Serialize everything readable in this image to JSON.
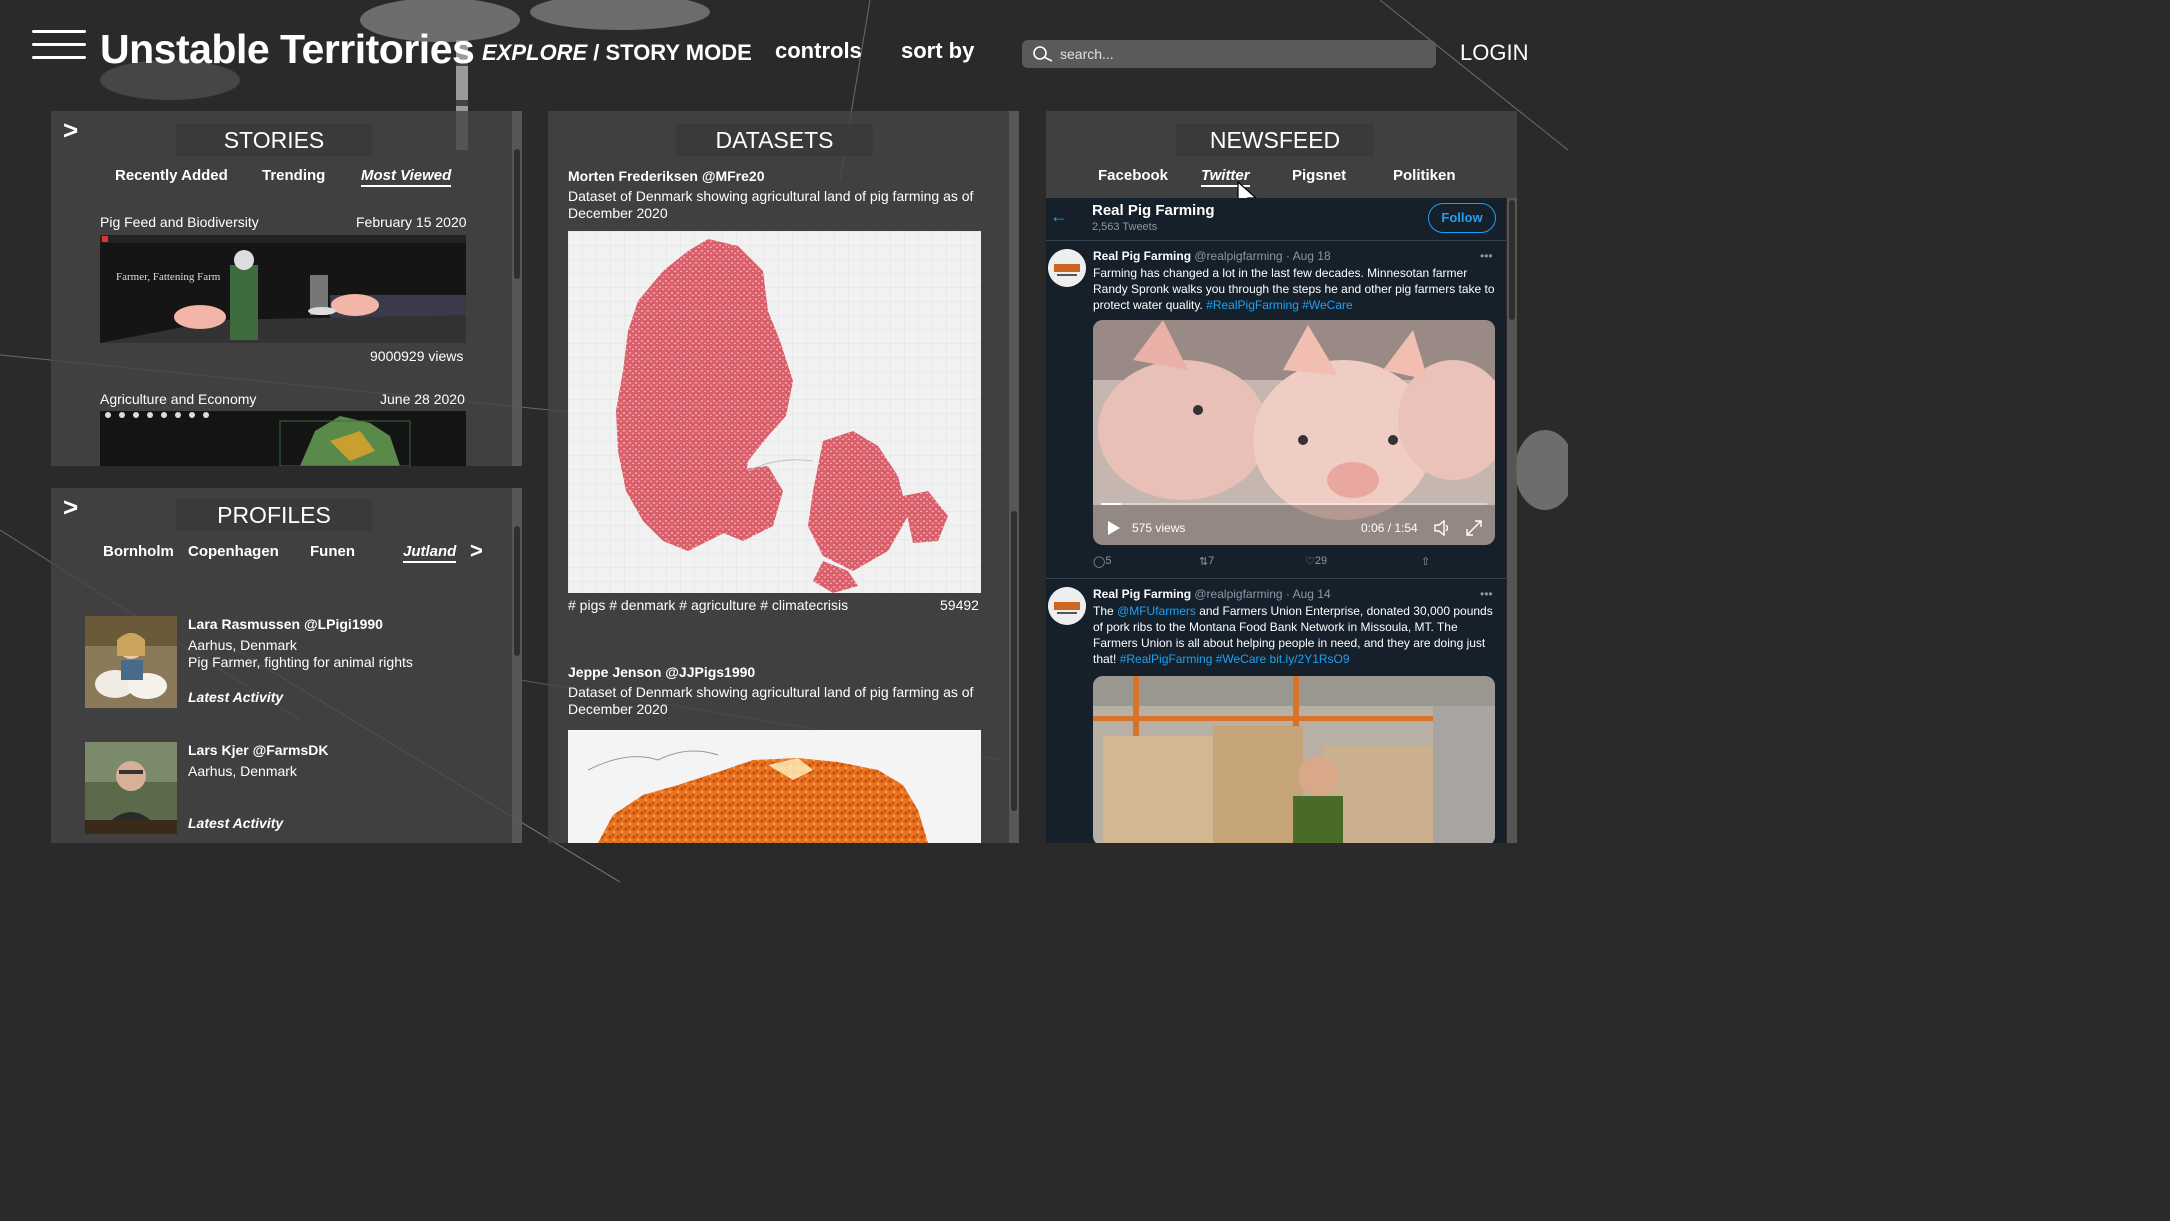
{
  "header": {
    "title": "Unstable Territories",
    "mode_explore": "EXPLORE",
    "mode_sep": " / ",
    "mode_story": "STORY MODE",
    "controls": "controls",
    "sort_by": "sort by",
    "search_placeholder": "search...",
    "login": "LOGIN"
  },
  "stories": {
    "title": "STORIES",
    "collapse": ">",
    "tabs": [
      "Recently Added",
      "Trending",
      "Most Viewed"
    ],
    "active_tab": "Most Viewed",
    "items": [
      {
        "title": "Pig Feed and Biodiversity",
        "date": "February 15 2020",
        "views": "9000929 views",
        "thumb_caption": "Farmer, Fattening Farm"
      },
      {
        "title": "Agriculture and Economy",
        "date": "June 28 2020"
      }
    ]
  },
  "profiles": {
    "title": "PROFILES",
    "collapse": ">",
    "tabs": [
      "Bornholm",
      "Copenhagen",
      "Funen",
      "Jutland"
    ],
    "active_tab": "Jutland",
    "next": ">",
    "items": [
      {
        "name": "Lara Rasmussen @LPigi1990",
        "location": "Aarhus, Denmark",
        "bio": "Pig Farmer, fighting for animal rights",
        "activity": "Latest Activity"
      },
      {
        "name": "Lars Kjer @FarmsDK",
        "location": "Aarhus, Denmark",
        "activity": "Latest Activity"
      }
    ]
  },
  "datasets": {
    "title": "DATASETS",
    "items": [
      {
        "author": "Morten Frederiksen @MFre20",
        "description": "Dataset of Denmark showing agricultural land of pig farming as of December 2020",
        "tags": "# pigs  # denmark  # agriculture  # climatecrisis",
        "count": "59492"
      },
      {
        "author": "Jeppe Jenson @JJPigs1990",
        "description": "Dataset of Denmark showing agricultural land of pig farming as of December 2020"
      }
    ]
  },
  "newsfeed": {
    "title": "NEWSFEED",
    "tabs": [
      "Facebook",
      "Twitter",
      "Pigsnet",
      "Politiken"
    ],
    "active_tab": "Twitter",
    "account": {
      "name": "Real Pig Farming",
      "tweets": "2,563 Tweets",
      "follow": "Follow"
    },
    "tweets": [
      {
        "author": "Real Pig Farming",
        "handle_date": "@realpigfarming · Aug 18",
        "text": "Farming has changed a lot in the last few decades. Minnesotan farmer Randy Spronk walks you through the steps he and other pig farmers take to protect water quality. ",
        "hashtags": "#RealPigFarming #WeCare",
        "video_views": "575 views",
        "video_time": "0:06 / 1:54",
        "replies": "5",
        "retweets": "7",
        "likes": "29"
      },
      {
        "author": "Real Pig Farming",
        "handle_date": "@realpigfarming · Aug 14",
        "text_before": "The ",
        "mention": "@MFUfarmers",
        "text_after": " and  Farmers Union Enterprise, donated 30,000 pounds of pork ribs to the Montana Food Bank Network in Missoula, MT. The Farmers Union is all about helping people in need, and they are doing just that! ",
        "hashtags": "#RealPigFarming #WeCare bit.ly/2Y1RsO9"
      }
    ]
  },
  "colors": {
    "background": "#2a2a2a",
    "panel": "#464646",
    "twitter_bg": "#15202b",
    "twitter_blue": "#1da1f2",
    "map_pink": "#d95f6b",
    "heat_orange": "#e8731f"
  }
}
